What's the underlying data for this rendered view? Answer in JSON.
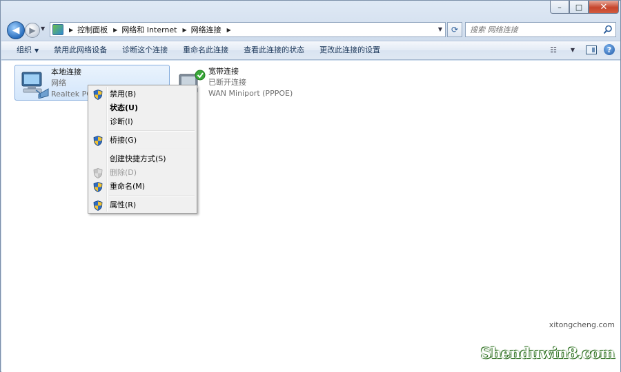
{
  "window": {
    "controls": {
      "minimize": "–",
      "maximize": "□",
      "close": "✕"
    }
  },
  "address": {
    "breadcrumbs": [
      "控制面板",
      "网络和 Internet",
      "网络连接"
    ],
    "search_placeholder": "搜索 网络连接"
  },
  "toolbar": {
    "organize": "组织",
    "commands": [
      "禁用此网络设备",
      "诊断这个连接",
      "重命名此连接",
      "查看此连接的状态",
      "更改此连接的设置"
    ]
  },
  "connections": [
    {
      "name": "本地连接",
      "status": "网络",
      "adapter": "Realtek PCI",
      "selected": true,
      "icon": "network-adapter-icon"
    },
    {
      "name": "宽带连接",
      "status": "已断开连接",
      "adapter": "WAN Miniport (PPPOE)",
      "selected": false,
      "icon": "broadband-connection-icon"
    }
  ],
  "context_menu": {
    "items": [
      {
        "label": "禁用(B)",
        "shield": true,
        "bold": false,
        "disabled": false
      },
      {
        "label": "状态(U)",
        "shield": false,
        "bold": true,
        "disabled": false
      },
      {
        "label": "诊断(I)",
        "shield": false,
        "bold": false,
        "disabled": false
      },
      {
        "label": "桥接(G)",
        "shield": true,
        "bold": false,
        "disabled": false
      },
      {
        "label": "创建快捷方式(S)",
        "shield": false,
        "bold": false,
        "disabled": false
      },
      {
        "label": "删除(D)",
        "shield": true,
        "bold": false,
        "disabled": true
      },
      {
        "label": "重命名(M)",
        "shield": true,
        "bold": false,
        "disabled": false
      },
      {
        "label": "属性(R)",
        "shield": true,
        "bold": false,
        "disabled": false
      }
    ]
  },
  "watermark": {
    "top": "xitongcheng.com",
    "main": "Shenduwin8.com"
  },
  "colors": {
    "accent": "#1e395b",
    "selection": "#d3e6fb",
    "shield_blue": "#2f6cc0",
    "shield_yellow": "#f2c230"
  }
}
